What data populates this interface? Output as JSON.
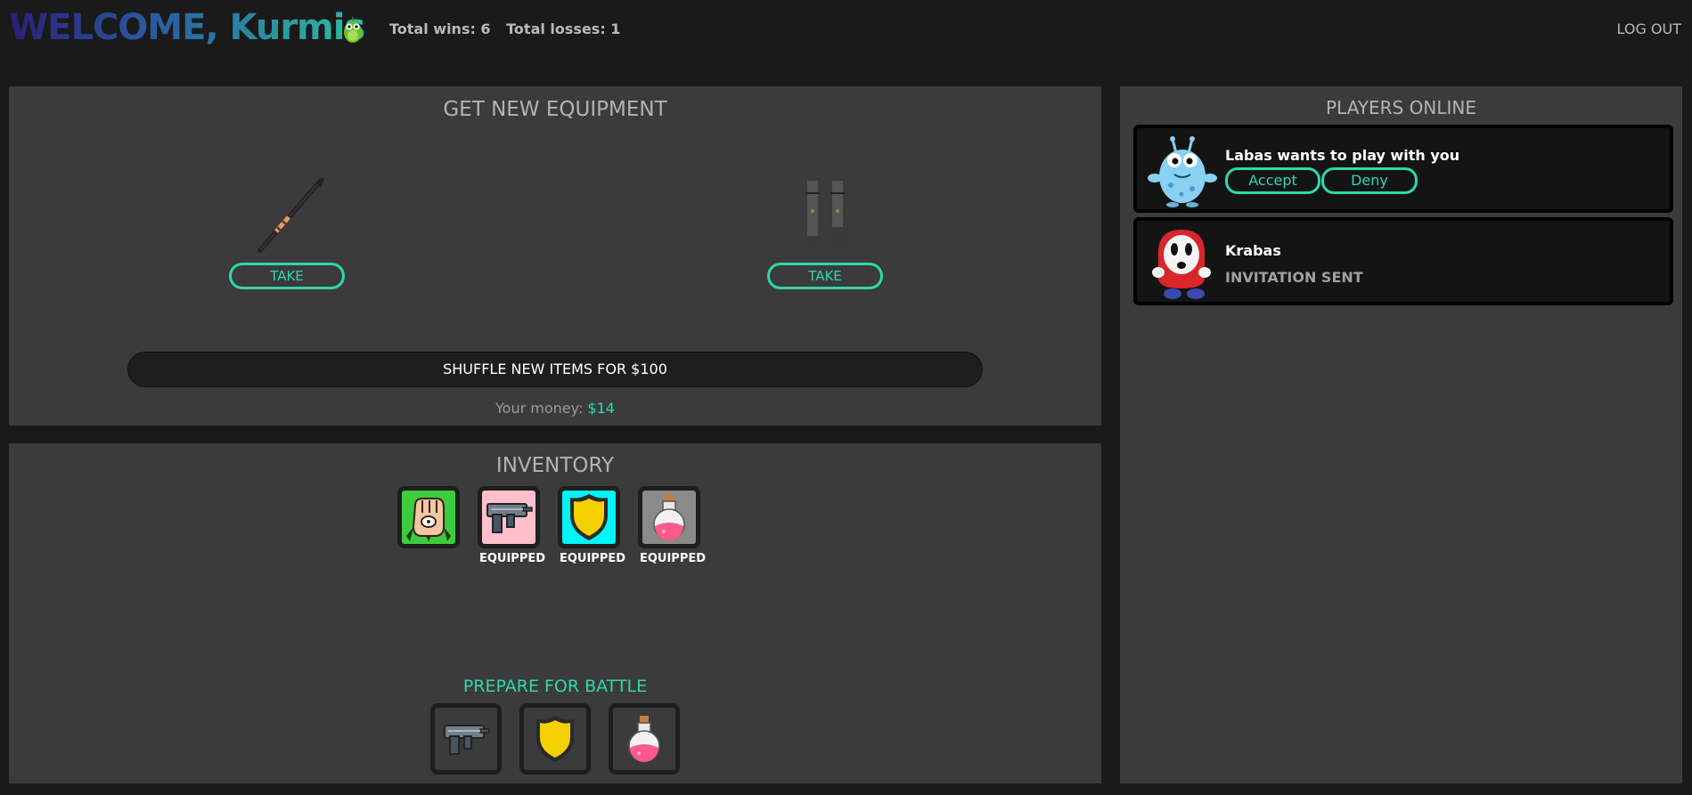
{
  "header": {
    "welcome": "WELCOME, Kurmis",
    "wins": "Total wins: 6",
    "losses": "Total losses: 1",
    "logout": "LOG OUT"
  },
  "equipment": {
    "title": "GET NEW EQUIPMENT",
    "offers": [
      {
        "item": "spear",
        "take_label": "TAKE"
      },
      {
        "item": "boots",
        "take_label": "TAKE"
      }
    ],
    "shuffle_label": "SHUFFLE NEW ITEMS FOR $100",
    "money_label": "Your money:",
    "money_value": "$14"
  },
  "inventory": {
    "title": "INVENTORY",
    "items": [
      {
        "icon": "fist-icon",
        "bg": "#3ccc3c",
        "status": ""
      },
      {
        "icon": "gun-icon",
        "bg": "#ffc0cb",
        "status": "EQUIPPED"
      },
      {
        "icon": "shield-icon",
        "bg": "#00f5f5",
        "status": "EQUIPPED"
      },
      {
        "icon": "potion-icon",
        "bg": "#8a8a8a",
        "status": "EQUIPPED"
      }
    ],
    "prepare_title": "PREPARE FOR BATTLE",
    "battle_items": [
      "gun-icon",
      "shield-icon",
      "potion-icon"
    ]
  },
  "players": {
    "title": "PLAYERS ONLINE",
    "list": [
      {
        "name": "Labas wants to play with you",
        "accept": "Accept",
        "deny": "Deny"
      },
      {
        "name": "Krabas",
        "status": "INVITATION SENT"
      }
    ]
  },
  "colors": {
    "accent": "#2fd8ad",
    "panel": "#3b3b3b",
    "background": "#1a1a1a"
  }
}
